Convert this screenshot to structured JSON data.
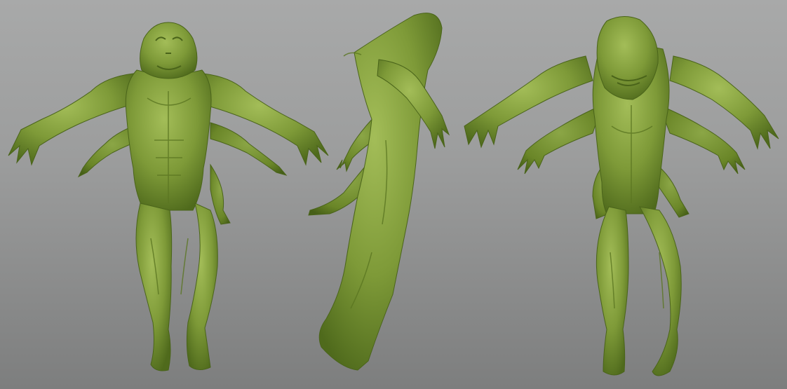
{
  "scene": {
    "kind": "3D sculpt turnaround render",
    "views": [
      "front",
      "side",
      "back"
    ],
    "colors": {
      "background_top": "#a8a9a9",
      "background_bottom": "#7d7e7e",
      "skin_base": "#7e9a38",
      "skin_light": "#a3bd58",
      "skin_shadow": "#4f6a1c"
    }
  }
}
